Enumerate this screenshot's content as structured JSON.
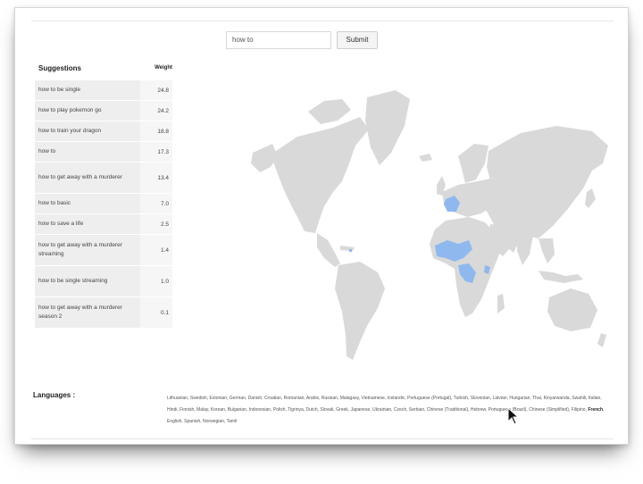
{
  "search": {
    "value": "how to",
    "submit_label": "Submit"
  },
  "suggestions": {
    "header": "Suggestions",
    "weight_header": "Weight",
    "rows": [
      {
        "text": "how to be single",
        "weight": "24.8"
      },
      {
        "text": "how to play pokemon go",
        "weight": "24.2"
      },
      {
        "text": "how to train your dragon",
        "weight": "18.8"
      },
      {
        "text": "how to",
        "weight": "17.3"
      },
      {
        "text": "how to get away with a murderer",
        "weight": "13.4"
      },
      {
        "text": "how to basic",
        "weight": "7.0"
      },
      {
        "text": "how to save a life",
        "weight": "2.5"
      },
      {
        "text": "how to get away with a murderer streaming",
        "weight": "1.4"
      },
      {
        "text": "how to be single streaming",
        "weight": "1.0"
      },
      {
        "text": "how to get away with a murderer season 2",
        "weight": "0.1"
      }
    ]
  },
  "map": {
    "base_color": "#d9d9d9",
    "highlight_color": "#8fb8ee"
  },
  "languages": {
    "label": "Languages :",
    "before": "Lithuanian, Swedish, Estonian, German, Danish, Croatian, Romanian, Arabic, Russian, Malagasy, Vietnamese, Icelandic, Portuguese (Portugal), Turkish, Slovenian, Latvian, Hungarian, Thai, Kinyarwanda, Swahili, Italian, Hindi, Finnish, Malay, Korean, Bulgarian, Indonesian, Polish, Tigrinya, Dutch, Slovak, Greek, Japanese, Ukrainian, Czech, Serbian, Chinese (Traditional), Hebrew, Portuguese (Brazil), Chinese (Simplified), Filipino, ",
    "highlight": "French",
    "after": ", English, Spanish, Norwegian, Tamil"
  }
}
